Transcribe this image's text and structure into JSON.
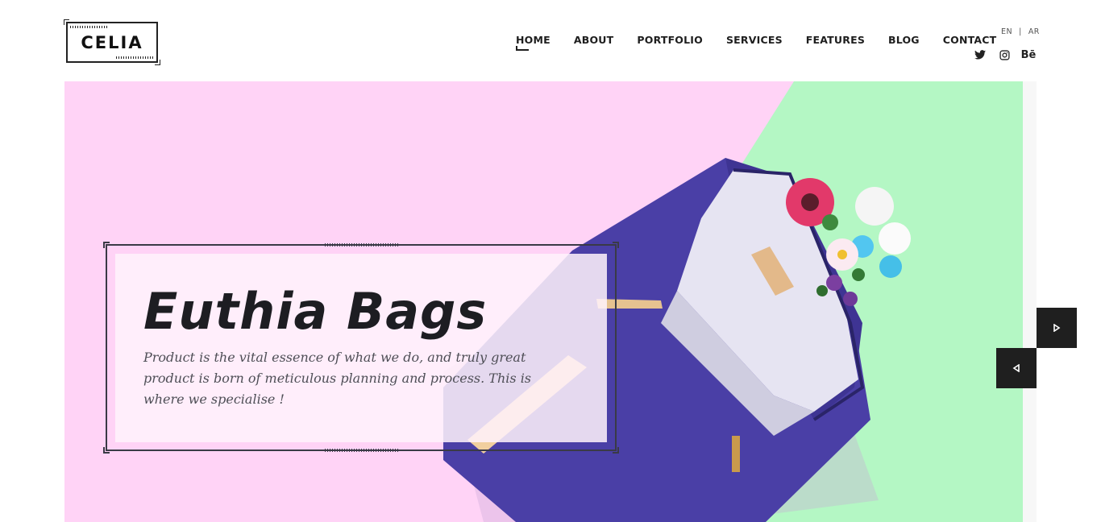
{
  "brand": {
    "logo_text": "CELIA"
  },
  "nav": {
    "items": [
      {
        "label": "HOME",
        "active": true
      },
      {
        "label": "ABOUT",
        "active": false
      },
      {
        "label": "PORTFOLIO",
        "active": false
      },
      {
        "label": "SERVICES",
        "active": false
      },
      {
        "label": "FEATURES",
        "active": false
      },
      {
        "label": "BLOG",
        "active": false
      },
      {
        "label": "CONTACT",
        "active": false
      }
    ]
  },
  "lang": {
    "en": "EN",
    "separator": "|",
    "ar": "AR"
  },
  "social": {
    "icons": [
      "twitter-icon",
      "instagram-icon",
      "behance-icon"
    ],
    "behance_label": "Bē"
  },
  "hero": {
    "title": "Euthia Bags",
    "text": "Product is the vital essence of what we do, and truly great product is born of meticulous planning and process. This is where we specialise !",
    "colors": {
      "pink": "#ffd3f6",
      "green": "#b4f7c4",
      "bag": "#4a3fa6",
      "panel": "#fff2fc",
      "dark": "#1f1f1f"
    }
  },
  "slider": {
    "next_icon": "play-right-icon",
    "prev_icon": "play-left-icon"
  }
}
